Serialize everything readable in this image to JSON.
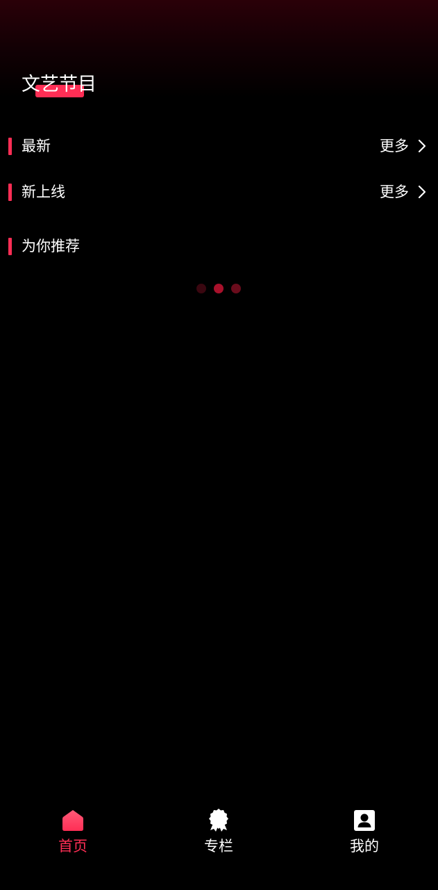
{
  "header": {
    "title": "文艺节目"
  },
  "sections": [
    {
      "label": "最新",
      "more_label": "更多"
    },
    {
      "label": "新上线",
      "more_label": "更多"
    },
    {
      "label": "为你推荐"
    }
  ],
  "loading": {
    "dot_colors": [
      "#3a0710",
      "#a8112b",
      "#6a0c1c"
    ]
  },
  "bottom_nav": {
    "items": [
      {
        "label": "首页",
        "icon": "home-icon",
        "active": true
      },
      {
        "label": "专栏",
        "icon": "ribbon-badge-icon",
        "active": false
      },
      {
        "label": "我的",
        "icon": "profile-card-icon",
        "active": false
      }
    ]
  },
  "colors": {
    "accent": "#ff2e55",
    "background": "#000000",
    "text": "#ffffff"
  }
}
